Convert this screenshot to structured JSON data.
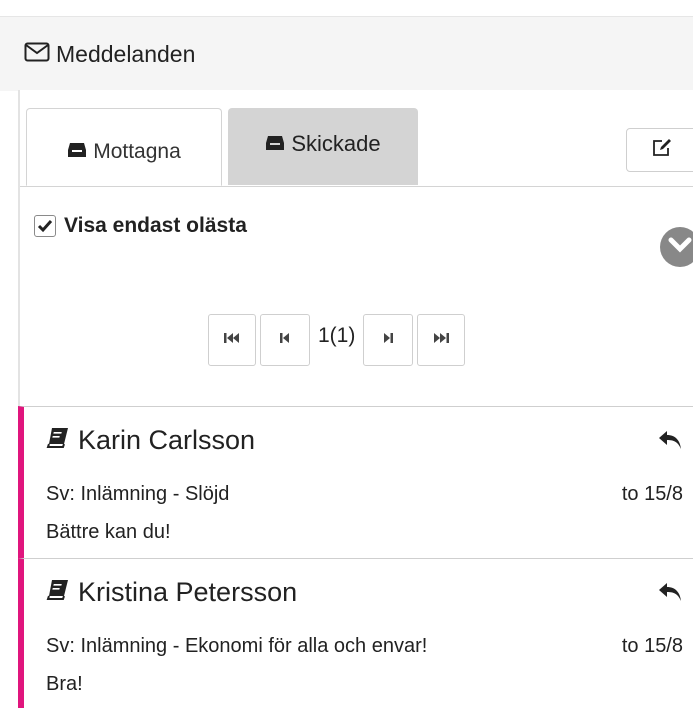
{
  "header": {
    "title": "Meddelanden",
    "icon": "envelope-icon"
  },
  "tabs": [
    {
      "label": "Mottagna",
      "active": true,
      "icon": "inbox-icon"
    },
    {
      "label": "Skickade",
      "active": false,
      "icon": "inbox-icon"
    }
  ],
  "compose": {
    "icon": "edit-icon"
  },
  "filter": {
    "label": "Visa endast olästa",
    "checked": true
  },
  "pager": {
    "label": "1(1)"
  },
  "messages": [
    {
      "sender": "Karin Carlsson",
      "subject": "Sv: Inlämning - Slöjd",
      "date": "to 15/8",
      "preview": "Bättre kan du!"
    },
    {
      "sender": "Kristina Petersson",
      "subject": "Sv: Inlämning - Ekonomi för alla och envar!",
      "date": "to 15/8",
      "preview": "Bra!"
    }
  ],
  "colors": {
    "unread_marker": "#e0157d",
    "header_bg": "#f5f5f5",
    "inactive_tab_bg": "#d4d4d4"
  }
}
